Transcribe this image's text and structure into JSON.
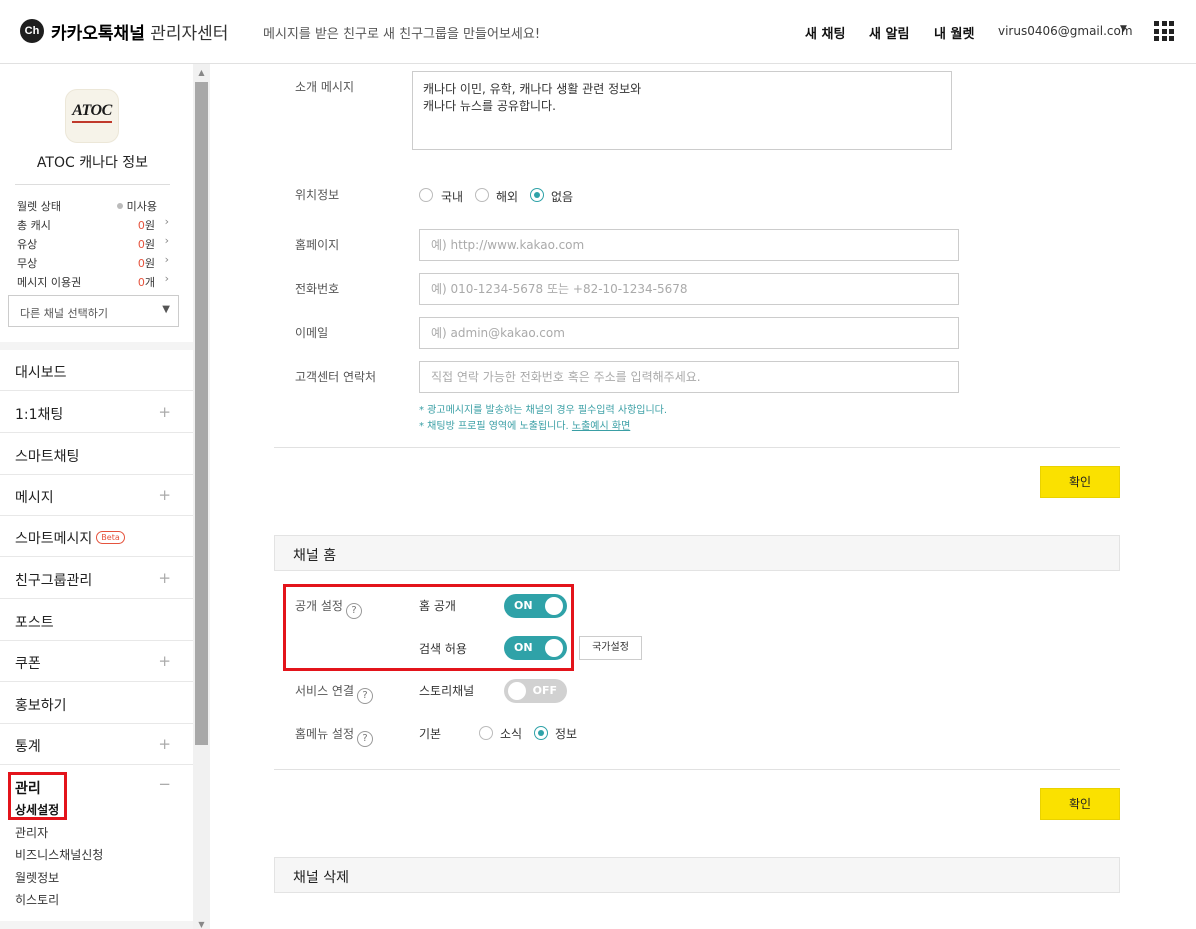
{
  "header": {
    "logo_glyph": "Ch",
    "brand_bold": "카카오톡채널",
    "brand_sub": "관리자센터",
    "notice": "메시지를 받은 친구로 새 친구그룹을 만들어보세요!",
    "nav": [
      "새 채팅",
      "새 알림",
      "내 월렛"
    ],
    "user_email": "virus0406@gmail.com",
    "user_caret": "▼"
  },
  "sidebar": {
    "profile": {
      "logo_text": "ATOC",
      "channel_name": "ATOC 캐나다 정보"
    },
    "wallet": {
      "status_label": "월렛 상태",
      "status_value": "미사용",
      "rows": [
        {
          "label": "총 캐시",
          "value": "0",
          "unit": "원"
        },
        {
          "label": "유상",
          "value": "0",
          "unit": "원"
        },
        {
          "label": "무상",
          "value": "0",
          "unit": "원"
        },
        {
          "label": "메시지 이용권",
          "value": "0",
          "unit": "개"
        }
      ]
    },
    "channel_select": "다른 채널 선택하기",
    "menu": [
      {
        "label": "대시보드"
      },
      {
        "label": "1:1채팅"
      },
      {
        "label": "스마트채팅"
      },
      {
        "label": "메시지"
      },
      {
        "label": "스마트메시지",
        "badge": "Beta"
      },
      {
        "label": "친구그룹관리"
      },
      {
        "label": "포스트"
      },
      {
        "label": "쿠폰"
      },
      {
        "label": "홍보하기"
      },
      {
        "label": "통계"
      }
    ],
    "manage": {
      "title": "관리",
      "subitems": [
        "상세설정",
        "관리자",
        "비즈니스채널신청",
        "월렛정보",
        "히스토리"
      ]
    }
  },
  "profile_form": {
    "intro_label": "소개 메시지",
    "intro_text": "캐나다 이민, 유학, 캐나다 생활 관련 정보와\n캐나다 뉴스를 공유합니다.",
    "location_label": "위치정보",
    "location_options": [
      "국내",
      "해외",
      "없음"
    ],
    "location_selected": "없음",
    "homepage_label": "홈페이지",
    "homepage_placeholder": "예) http://www.kakao.com",
    "phone_label": "전화번호",
    "phone_placeholder": "예) 010-1234-5678 또는 +82-10-1234-5678",
    "email_label": "이메일",
    "email_placeholder": "예) admin@kakao.com",
    "cs_label": "고객센터 연락처",
    "cs_placeholder": "직접 연락 가능한 전화번호 혹은 주소를 입력해주세요.",
    "note1": "* 광고메시지를 발송하는 채널의 경우 필수입력 사항입니다.",
    "note2": "* 채팅방 프로필 영역에 노출됩니다.",
    "note2_link": "노출예시 화면",
    "confirm": "확인"
  },
  "channel_home": {
    "title": "채널 홈",
    "public_label": "공개 설정",
    "home_public_label": "홈 공개",
    "home_public_state": "ON",
    "search_label": "검색 허용",
    "search_state": "ON",
    "country_button": "국가설정",
    "service_label": "서비스 연결",
    "story_label": "스토리채널",
    "story_state": "OFF",
    "menu_label": "홈메뉴 설정",
    "menu_default": "기본",
    "menu_options": [
      "소식",
      "정보"
    ],
    "menu_selected": "정보",
    "confirm": "확인",
    "help_glyph": "?"
  },
  "delete_section": {
    "title": "채널 삭제"
  },
  "colors": {
    "accent": "#2fa2a8",
    "confirm_yellow": "#fae100",
    "highlight_red": "#e3141b",
    "money_red": "#e5533d"
  }
}
